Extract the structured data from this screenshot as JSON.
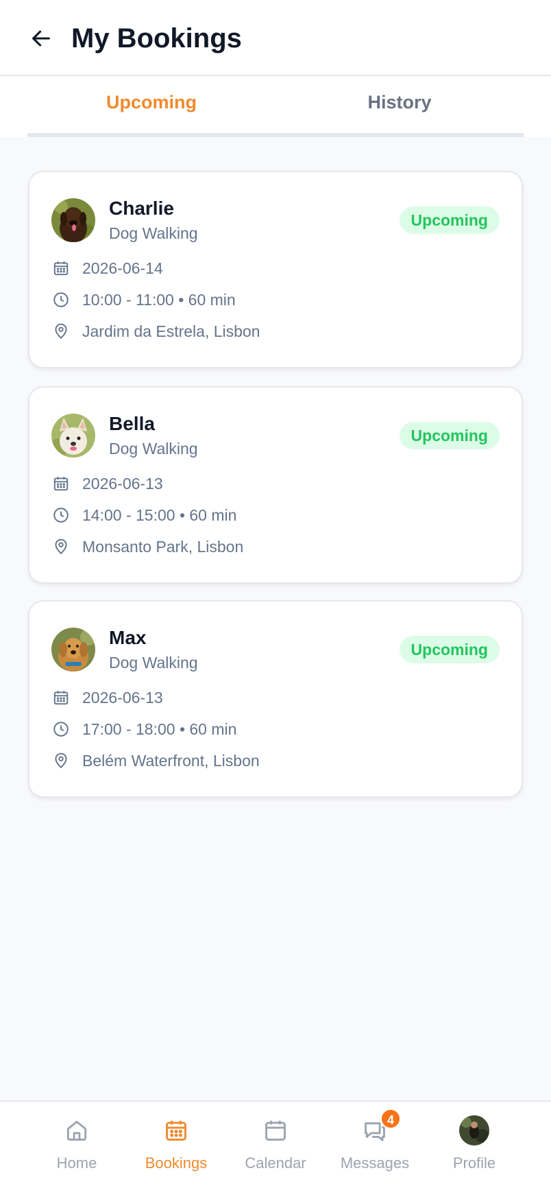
{
  "header": {
    "title": "My Bookings",
    "back_icon": "arrow-left-icon"
  },
  "tabs": [
    {
      "label": "Upcoming",
      "active": true
    },
    {
      "label": "History",
      "active": false
    }
  ],
  "colors": {
    "accent": "#f08a2c",
    "status_bg": "#dcfce7",
    "status_text": "#22c55e",
    "muted": "#64748b"
  },
  "bookings": [
    {
      "pet_name": "Charlie",
      "service": "Dog Walking",
      "status": "Upcoming",
      "date": "2026-06-14",
      "time": "10:00 - 11:00 • 60 min",
      "location": "Jardim da Estrela, Lisbon",
      "avatar": "chocolate-labrador"
    },
    {
      "pet_name": "Bella",
      "service": "Dog Walking",
      "status": "Upcoming",
      "date": "2026-06-13",
      "time": "14:00 - 15:00 • 60 min",
      "location": "Monsanto Park, Lisbon",
      "avatar": "french-bulldog"
    },
    {
      "pet_name": "Max",
      "service": "Dog Walking",
      "status": "Upcoming",
      "date": "2026-06-13",
      "time": "17:00 - 18:00 • 60 min",
      "location": "Belém Waterfront, Lisbon",
      "avatar": "golden-retriever"
    }
  ],
  "nav": [
    {
      "label": "Home",
      "icon": "home-icon",
      "active": false
    },
    {
      "label": "Bookings",
      "icon": "calendar-grid-icon",
      "active": true
    },
    {
      "label": "Calendar",
      "icon": "calendar-icon",
      "active": false
    },
    {
      "label": "Messages",
      "icon": "chat-icon",
      "active": false,
      "badge": "4"
    },
    {
      "label": "Profile",
      "icon": "avatar",
      "active": false
    }
  ]
}
